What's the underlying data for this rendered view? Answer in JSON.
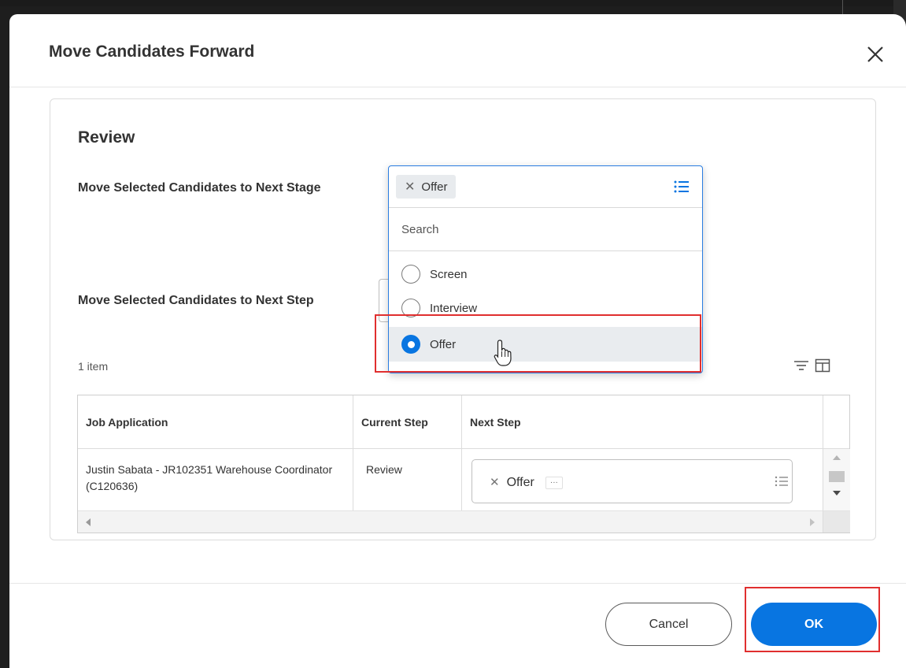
{
  "dialog": {
    "title": "Move Candidates Forward",
    "close_icon": "close-icon"
  },
  "review": {
    "section_title": "Review",
    "stage_label": "Move Selected Candidates to Next Stage",
    "step_label": "Move Selected Candidates to Next Step"
  },
  "stage_dropdown": {
    "selected_chip": "Offer",
    "search_placeholder": "Search",
    "options": [
      {
        "label": "Screen",
        "selected": false
      },
      {
        "label": "Interview",
        "selected": false
      },
      {
        "label": "Offer",
        "selected": true
      }
    ]
  },
  "table": {
    "item_count": "1 item",
    "columns": [
      "Job Application",
      "Current Step",
      "Next Step"
    ],
    "rows": [
      {
        "job_application": "Justin Sabata - JR102351 Warehouse Coordinator (C120636)",
        "current_step": "Review",
        "next_step": "Offer"
      }
    ]
  },
  "footer": {
    "cancel_label": "Cancel",
    "ok_label": "OK"
  },
  "colors": {
    "accent": "#0875e1",
    "focus_border": "#2a7de1",
    "annotation": "#e02f2f"
  }
}
